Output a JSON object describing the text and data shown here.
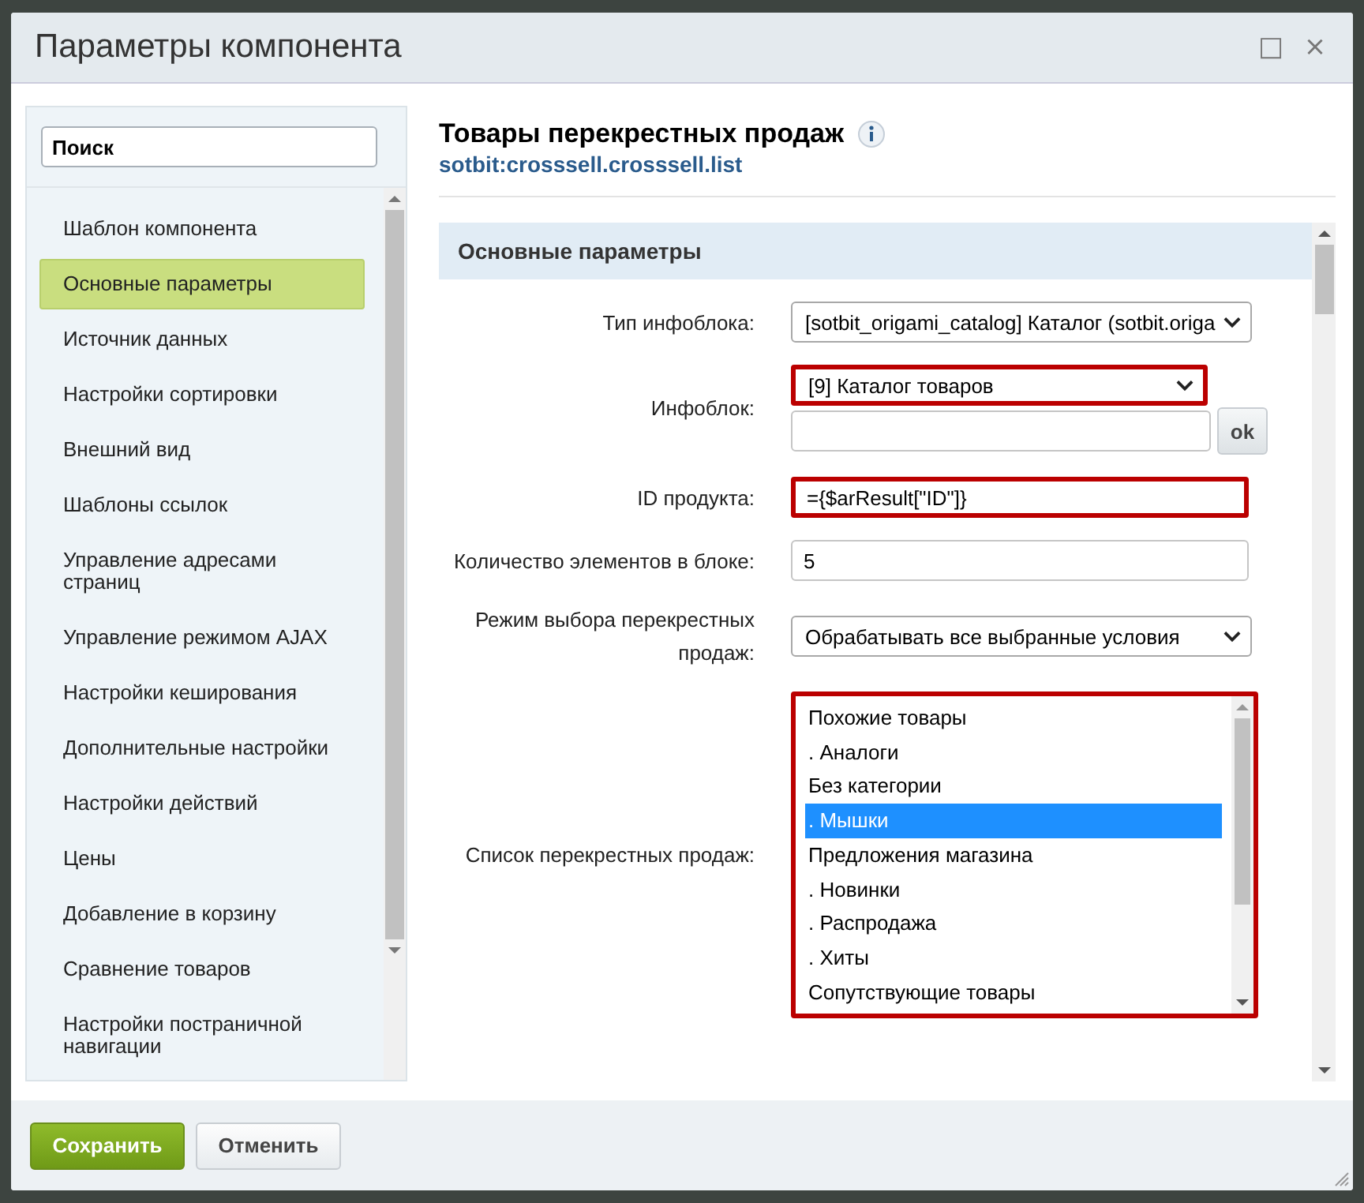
{
  "window": {
    "title": "Параметры компонента",
    "controls": [
      "□",
      "×"
    ]
  },
  "sidebar": {
    "search": {
      "value": "Поиск"
    },
    "items": [
      {
        "label": "Шаблон компонента",
        "selected": false
      },
      {
        "label": "Основные параметры",
        "selected": true
      },
      {
        "label": "Источник данных",
        "selected": false
      },
      {
        "label": "Настройки сортировки",
        "selected": false
      },
      {
        "label": "Внешний вид",
        "selected": false
      },
      {
        "label": "Шаблоны ссылок",
        "selected": false
      },
      {
        "label": "Управление адресами страниц",
        "selected": false
      },
      {
        "label": "Управление режимом AJAX",
        "selected": false
      },
      {
        "label": "Настройки кеширования",
        "selected": false
      },
      {
        "label": "Дополнительные настройки",
        "selected": false
      },
      {
        "label": "Настройки действий",
        "selected": false
      },
      {
        "label": "Цены",
        "selected": false
      },
      {
        "label": "Добавление в корзину",
        "selected": false
      },
      {
        "label": "Сравнение товаров",
        "selected": false
      },
      {
        "label": "Настройки постраничной навигации",
        "selected": false
      }
    ]
  },
  "component": {
    "title": "Товары перекрестных продаж",
    "code": "sotbit:crosssell.crosssell.list"
  },
  "section": {
    "title": "Основные параметры",
    "rows": [
      {
        "kind": "select",
        "label": "Тип инфоблока:",
        "value": "[sotbit_origami_catalog] Каталог (sotbit.origa",
        "highlighted": false
      },
      {
        "kind": "select-extra",
        "label": "Инфоблок:",
        "value": "[9] Каталог товаров",
        "highlighted": true,
        "button": "ok"
      },
      {
        "kind": "input",
        "label": "ID продукта:",
        "value": "={$arResult[\"ID\"]}",
        "highlighted": true
      },
      {
        "kind": "input",
        "label": "Количество элементов в блоке:",
        "value": "5",
        "highlighted": false
      },
      {
        "kind": "select",
        "label": "Режим выбора перекрестных продаж:",
        "value": "Обрабатывать все выбранные условия",
        "highlighted": false
      },
      {
        "kind": "list",
        "label": "Список перекрестных продаж:",
        "highlighted": true,
        "options": [
          {
            "label": "Похожие товары",
            "selected": false
          },
          {
            "label": ". Аналоги",
            "selected": false
          },
          {
            "label": "Без категории",
            "selected": false
          },
          {
            "label": ". Мышки",
            "selected": true
          },
          {
            "label": "Предложения магазина",
            "selected": false
          },
          {
            "label": ". Новинки",
            "selected": false
          },
          {
            "label": ". Распродажа",
            "selected": false
          },
          {
            "label": ". Хиты",
            "selected": false
          },
          {
            "label": "Сопутствующие товары",
            "selected": false
          }
        ]
      }
    ]
  },
  "buttons": [
    {
      "label": "Сохранить",
      "kind": "primary"
    },
    {
      "label": "Отменить",
      "kind": "secondary"
    }
  ]
}
